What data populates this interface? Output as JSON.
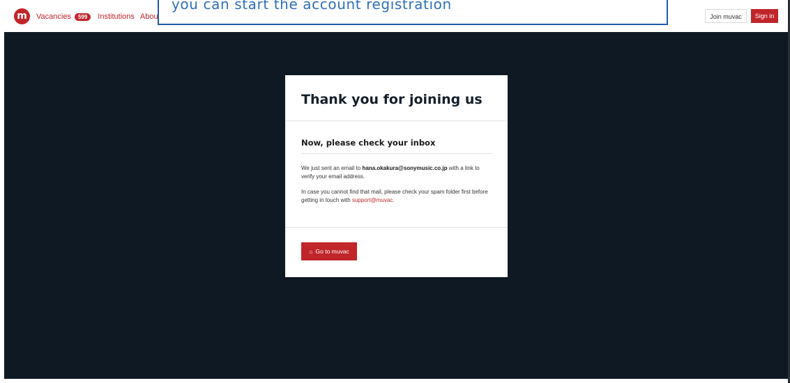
{
  "nav": {
    "logo_letter": "m",
    "vacancies_label": "Vacancies",
    "vacancies_count": "599",
    "institutions_label": "Institutions",
    "about_label": "About",
    "join_label": "Join muvac",
    "signin_label": "Sign in"
  },
  "callout": {
    "text": "you can start the account registration"
  },
  "card": {
    "title": "Thank you for joining us",
    "subtitle": "Now, please check your inbox",
    "p1_prefix": "We just sent an email to ",
    "p1_email": "hana.okakura@sonymusic.co.jp",
    "p1_suffix": " with a link to verify your email address.",
    "p2_prefix": "In case you cannot find that mail, please check your spam folder first before getting in touch with ",
    "p2_link": "support@muvac",
    "p2_suffix": ".",
    "button_label": "Go to muvac",
    "button_icon": "home-icon"
  },
  "colors": {
    "brand_red": "#c0252a",
    "background_dark": "#0f1923",
    "callout_blue": "#2e6fb8"
  }
}
